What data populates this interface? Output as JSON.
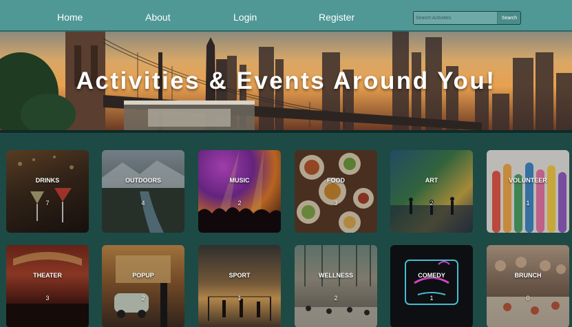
{
  "nav": {
    "home": "Home",
    "about": "About",
    "login": "Login",
    "register": "Register",
    "search_placeholder": "Search Activities",
    "search_button": "Search"
  },
  "hero": {
    "title": "Activities & Events Around You!"
  },
  "categories": [
    {
      "name": "DRINKS",
      "count": "7"
    },
    {
      "name": "OUTDOORS",
      "count": "4"
    },
    {
      "name": "MUSIC",
      "count": "2"
    },
    {
      "name": "FOOD",
      "count": "3"
    },
    {
      "name": "ART",
      "count": "2"
    },
    {
      "name": "VOLUNTEER",
      "count": "1"
    },
    {
      "name": "THEATER",
      "count": "3"
    },
    {
      "name": "POPUP",
      "count": "2"
    },
    {
      "name": "SPORT",
      "count": "1"
    },
    {
      "name": "WELLNESS",
      "count": "2"
    },
    {
      "name": "COMEDY",
      "count": "1"
    },
    {
      "name": "BRUNCH",
      "count": "0"
    }
  ],
  "colors": {
    "nav_bg": "#4f9896",
    "page_bg": "#1d4a45"
  }
}
